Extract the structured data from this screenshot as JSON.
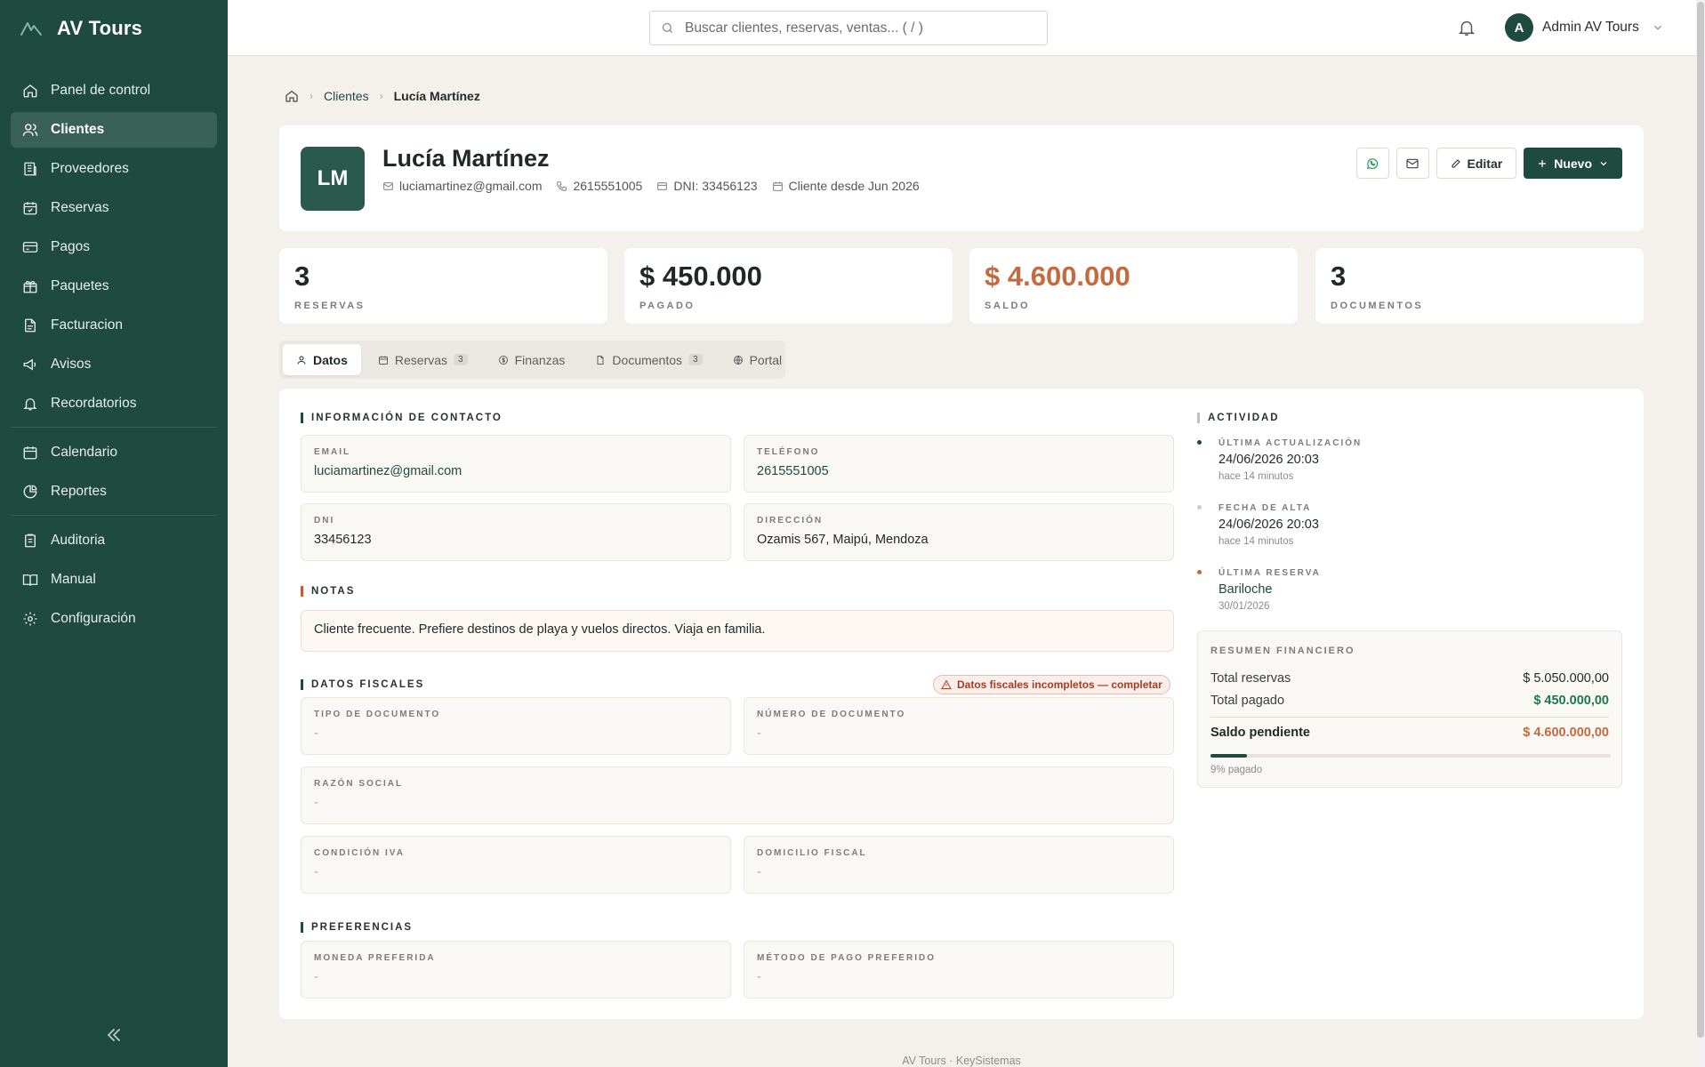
{
  "app": {
    "name": "AV Tours"
  },
  "sidebar": {
    "items": [
      {
        "label": "Panel de control",
        "icon": "home-icon"
      },
      {
        "label": "Clientes",
        "icon": "users-icon",
        "active": true
      },
      {
        "label": "Proveedores",
        "icon": "building-icon"
      },
      {
        "label": "Reservas",
        "icon": "calendar-check-icon"
      },
      {
        "label": "Pagos",
        "icon": "credit-card-icon"
      },
      {
        "label": "Paquetes",
        "icon": "gift-icon"
      },
      {
        "label": "Facturacion",
        "icon": "file-text-icon"
      },
      {
        "label": "Avisos",
        "icon": "megaphone-icon"
      },
      {
        "label": "Recordatorios",
        "icon": "bell-icon"
      },
      {
        "label": "Calendario",
        "icon": "calendar-icon"
      },
      {
        "label": "Reportes",
        "icon": "pie-chart-icon"
      },
      {
        "label": "Auditoria",
        "icon": "clipboard-icon"
      },
      {
        "label": "Manual",
        "icon": "book-icon"
      },
      {
        "label": "Configuración",
        "icon": "settings-icon"
      }
    ]
  },
  "topbar": {
    "search_placeholder": "Buscar clientes, reservas, ventas... ( / )",
    "user_initial": "A",
    "user_name": "Admin AV Tours"
  },
  "breadcrumb": {
    "section": "Clientes",
    "current": "Lucía Martínez"
  },
  "client": {
    "initials": "LM",
    "name": "Lucía Martínez",
    "email": "luciamartinez@gmail.com",
    "phone": "2615551005",
    "dni": "DNI: 33456123",
    "since": "Cliente desde Jun 2026"
  },
  "actions": {
    "edit": "Editar",
    "new": "Nuevo"
  },
  "stats": [
    {
      "value": "3",
      "label": "RESERVAS"
    },
    {
      "value": "$ 450.000",
      "label": "PAGADO"
    },
    {
      "value": "$ 4.600.000",
      "label": "SALDO"
    },
    {
      "value": "3",
      "label": "DOCUMENTOS"
    }
  ],
  "tabs": [
    {
      "label": "Datos",
      "badge": ""
    },
    {
      "label": "Reservas",
      "badge": "3"
    },
    {
      "label": "Finanzas",
      "badge": ""
    },
    {
      "label": "Documentos",
      "badge": "3"
    },
    {
      "label": "Portal",
      "badge": ""
    }
  ],
  "contact": {
    "title": "INFORMACIÓN DE CONTACTO",
    "email_label": "EMAIL",
    "email": "luciamartinez@gmail.com",
    "phone_label": "TELÉFONO",
    "phone": "2615551005",
    "dni_label": "DNI",
    "dni": "33456123",
    "address_label": "DIRECCIÓN",
    "address": "Ozamis 567, Maipú, Mendoza"
  },
  "notes": {
    "title": "NOTAS",
    "text": "Cliente frecuente. Prefiere destinos de playa y vuelos directos. Viaja en familia."
  },
  "fiscal": {
    "title": "DATOS FISCALES",
    "warning": "Datos fiscales incompletos — completar",
    "doc_type_label": "TIPO DE DOCUMENTO",
    "doc_type": "-",
    "doc_number_label": "NÚMERO DE DOCUMENTO",
    "doc_number": "-",
    "business_name_label": "RAZÓN SOCIAL",
    "business_name": "-",
    "iva_label": "CONDICIÓN IVA",
    "iva": "-",
    "fiscal_address_label": "DOMICILIO FISCAL",
    "fiscal_address": "-"
  },
  "preferences": {
    "title": "PREFERENCIAS",
    "currency_label": "MONEDA PREFERIDA",
    "currency": "-",
    "payment_label": "MÉTODO DE PAGO PREFERIDO",
    "payment": "-"
  },
  "activity": {
    "title": "ACTIVIDAD",
    "items": [
      {
        "label": "ÚLTIMA ACTUALIZACIÓN",
        "value": "24/06/2026 20:03",
        "sub": "hace 14 minutos"
      },
      {
        "label": "FECHA DE ALTA",
        "value": "24/06/2026 20:03",
        "sub": "hace 14 minutos"
      },
      {
        "label": "ÚLTIMA RESERVA",
        "value": "Bariloche",
        "sub": "30/01/2026"
      }
    ]
  },
  "finance": {
    "title": "RESUMEN FINANCIERO",
    "total_reservas_label": "Total reservas",
    "total_reservas": "$ 5.050.000,00",
    "total_pagado_label": "Total pagado",
    "total_pagado": "$ 450.000,00",
    "saldo_label": "Saldo pendiente",
    "saldo": "$ 4.600.000,00",
    "paid_fraction": 0.09,
    "paid_text": "9% pagado"
  },
  "footer": "AV Tours · KeySistemas",
  "colors": {
    "brand": "#1e4a3f",
    "accent_orange": "#c46a3e",
    "warning": "#a33d25"
  }
}
